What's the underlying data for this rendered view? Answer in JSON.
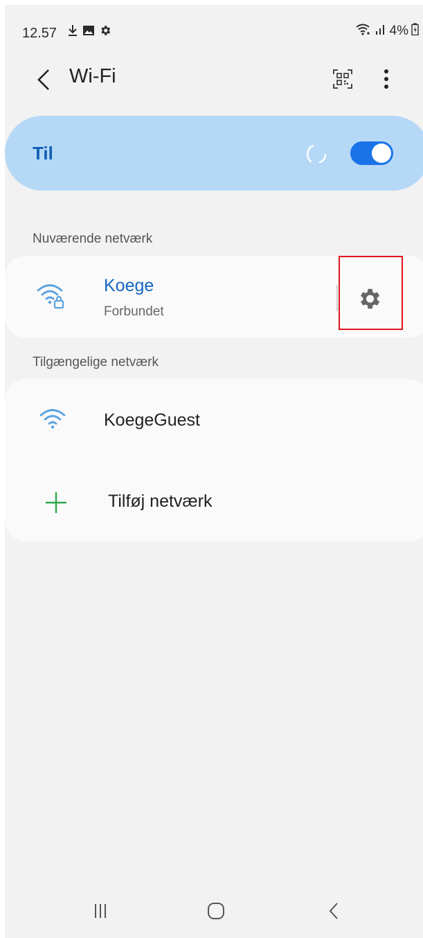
{
  "status_bar": {
    "time": "12.57",
    "battery": "4%"
  },
  "header": {
    "title": "Wi-Fi"
  },
  "master_toggle": {
    "label": "Til",
    "state": "on"
  },
  "current_network": {
    "section_label": "Nuværende netværk",
    "name": "Koege",
    "status": "Forbundet",
    "name_color": "#1565c0"
  },
  "available_networks": {
    "section_label": "Tilgængelige netværk",
    "items": [
      {
        "name": "KoegeGuest"
      }
    ],
    "add_label": "Tilføj netværk"
  },
  "colors": {
    "accent": "#1a73e8",
    "master_card_bg": "#b6d8f7",
    "wifi_icon": "#5aa3e0",
    "add_icon": "#2aa84a",
    "highlight": "#e0141a"
  }
}
